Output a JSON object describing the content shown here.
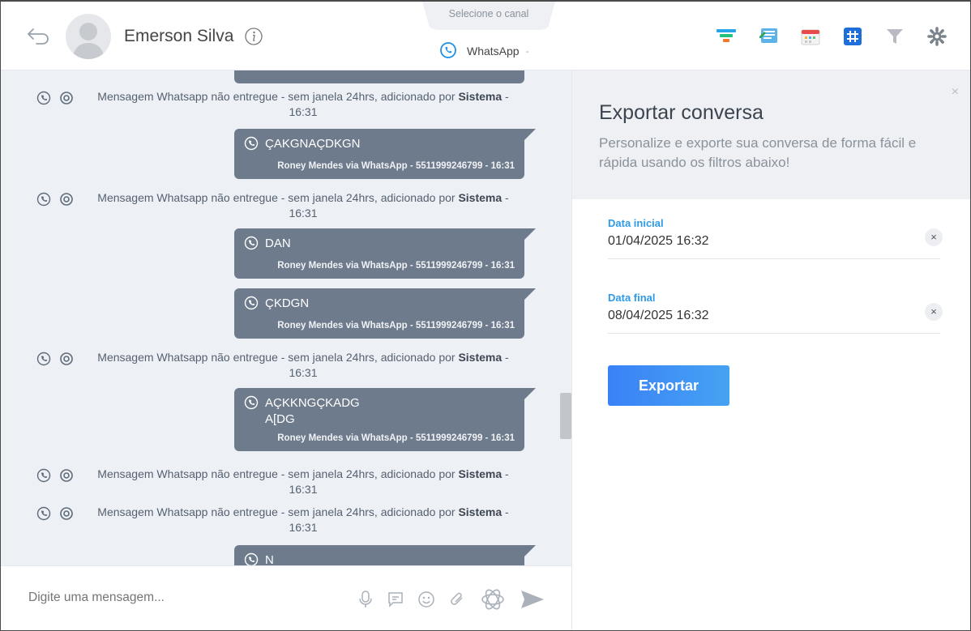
{
  "header": {
    "contact_name": "Emerson Silva",
    "channel_tab_label": "Selecione o canal",
    "channel_value": "WhatsApp",
    "channel_caret": "-"
  },
  "chat": {
    "system_rows": [
      {
        "prefix": "Mensagem Whatsapp não entregue - sem janela 24hrs, adicionado por",
        "author": "Sistema",
        "suffix": "-",
        "time": "16:31"
      },
      {
        "prefix": "Mensagem Whatsapp não entregue - sem janela 24hrs, adicionado por",
        "author": "Sistema",
        "suffix": "-",
        "time": "16:31"
      },
      {
        "prefix": "Mensagem Whatsapp não entregue - sem janela 24hrs, adicionado por",
        "author": "Sistema",
        "suffix": "-",
        "time": "16:31"
      },
      {
        "prefix": "Mensagem Whatsapp não entregue - sem janela 24hrs, adicionado por",
        "author": "Sistema",
        "suffix": "-",
        "time": "16:31"
      },
      {
        "prefix": "Mensagem Whatsapp não entregue - sem janela 24hrs, adicionado por",
        "author": "Sistema",
        "suffix": "-",
        "time": "16:31"
      }
    ],
    "bubbles": [
      {
        "text": "ÇAKGNAÇDKGN",
        "meta": "Roney Mendes via WhatsApp - 5511999246799 - 16:31"
      },
      {
        "text": "DAN",
        "meta": "Roney Mendes via WhatsApp - 5511999246799 - 16:31"
      },
      {
        "text": "ÇKDGN",
        "meta": "Roney Mendes via WhatsApp - 5511999246799 - 16:31"
      },
      {
        "text": "AÇKKNGÇKADG",
        "text2": "A[DG",
        "meta": "Roney Mendes via WhatsApp - 5511999246799 - 16:31"
      },
      {
        "text": "N"
      }
    ]
  },
  "compose": {
    "placeholder": "Digite uma mensagem..."
  },
  "export": {
    "title": "Exportar conversa",
    "subtitle": "Personalize e exporte sua conversa de forma fácil e rápida usando os filtros abaixo!",
    "close": "×",
    "start_label": "Data inicial",
    "start_value": "01/04/2025 16:32",
    "end_label": "Data final",
    "end_value": "08/04/2025 16:32",
    "clear": "×",
    "button": "Exportar"
  },
  "colors": {
    "bubble": "#6e7b8c",
    "accent": "#2f9ae5",
    "whatsapp": "#1e90e6"
  }
}
